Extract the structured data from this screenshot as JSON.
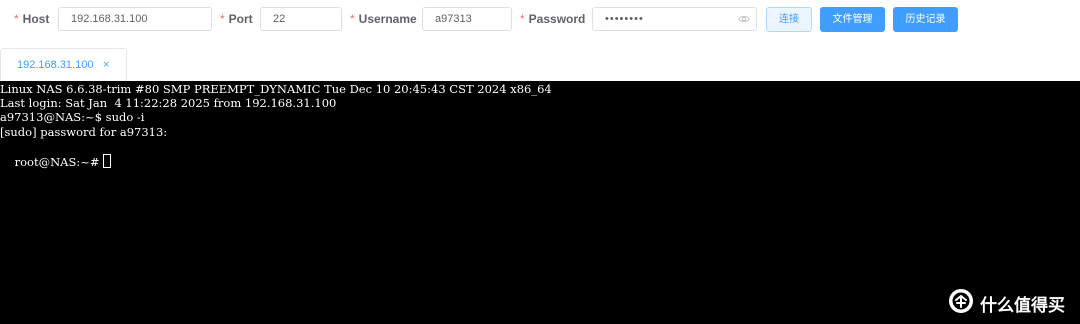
{
  "connection_form": {
    "required_mark": "*",
    "host": {
      "label": "Host",
      "value": "192.168.31.100"
    },
    "port": {
      "label": "Port",
      "value": "22"
    },
    "username": {
      "label": "Username",
      "value": "a97313"
    },
    "password": {
      "label": "Password",
      "value": "••••••••"
    },
    "buttons": {
      "connect": "连接",
      "file_manager": "文件管理",
      "history": "历史记录"
    }
  },
  "tabs": [
    {
      "label": "192.168.31.100",
      "close": "×",
      "active": true
    }
  ],
  "terminal": {
    "lines": [
      "Linux NAS 6.6.38-trim #80 SMP PREEMPT_DYNAMIC Tue Dec 10 20:45:43 CST 2024 x86_64",
      "Last login: Sat Jan  4 11:22:28 2025 from 192.168.31.100",
      "a97313@NAS:~$ sudo -i",
      "[sudo] password for a97313:",
      "root@NAS:~#"
    ]
  },
  "watermark": {
    "text": "什么值得买",
    "icon": "smzdm-logo-icon"
  },
  "colors": {
    "primary": "#409eff",
    "required": "#f56c6c",
    "terminal_bg": "#000000"
  }
}
